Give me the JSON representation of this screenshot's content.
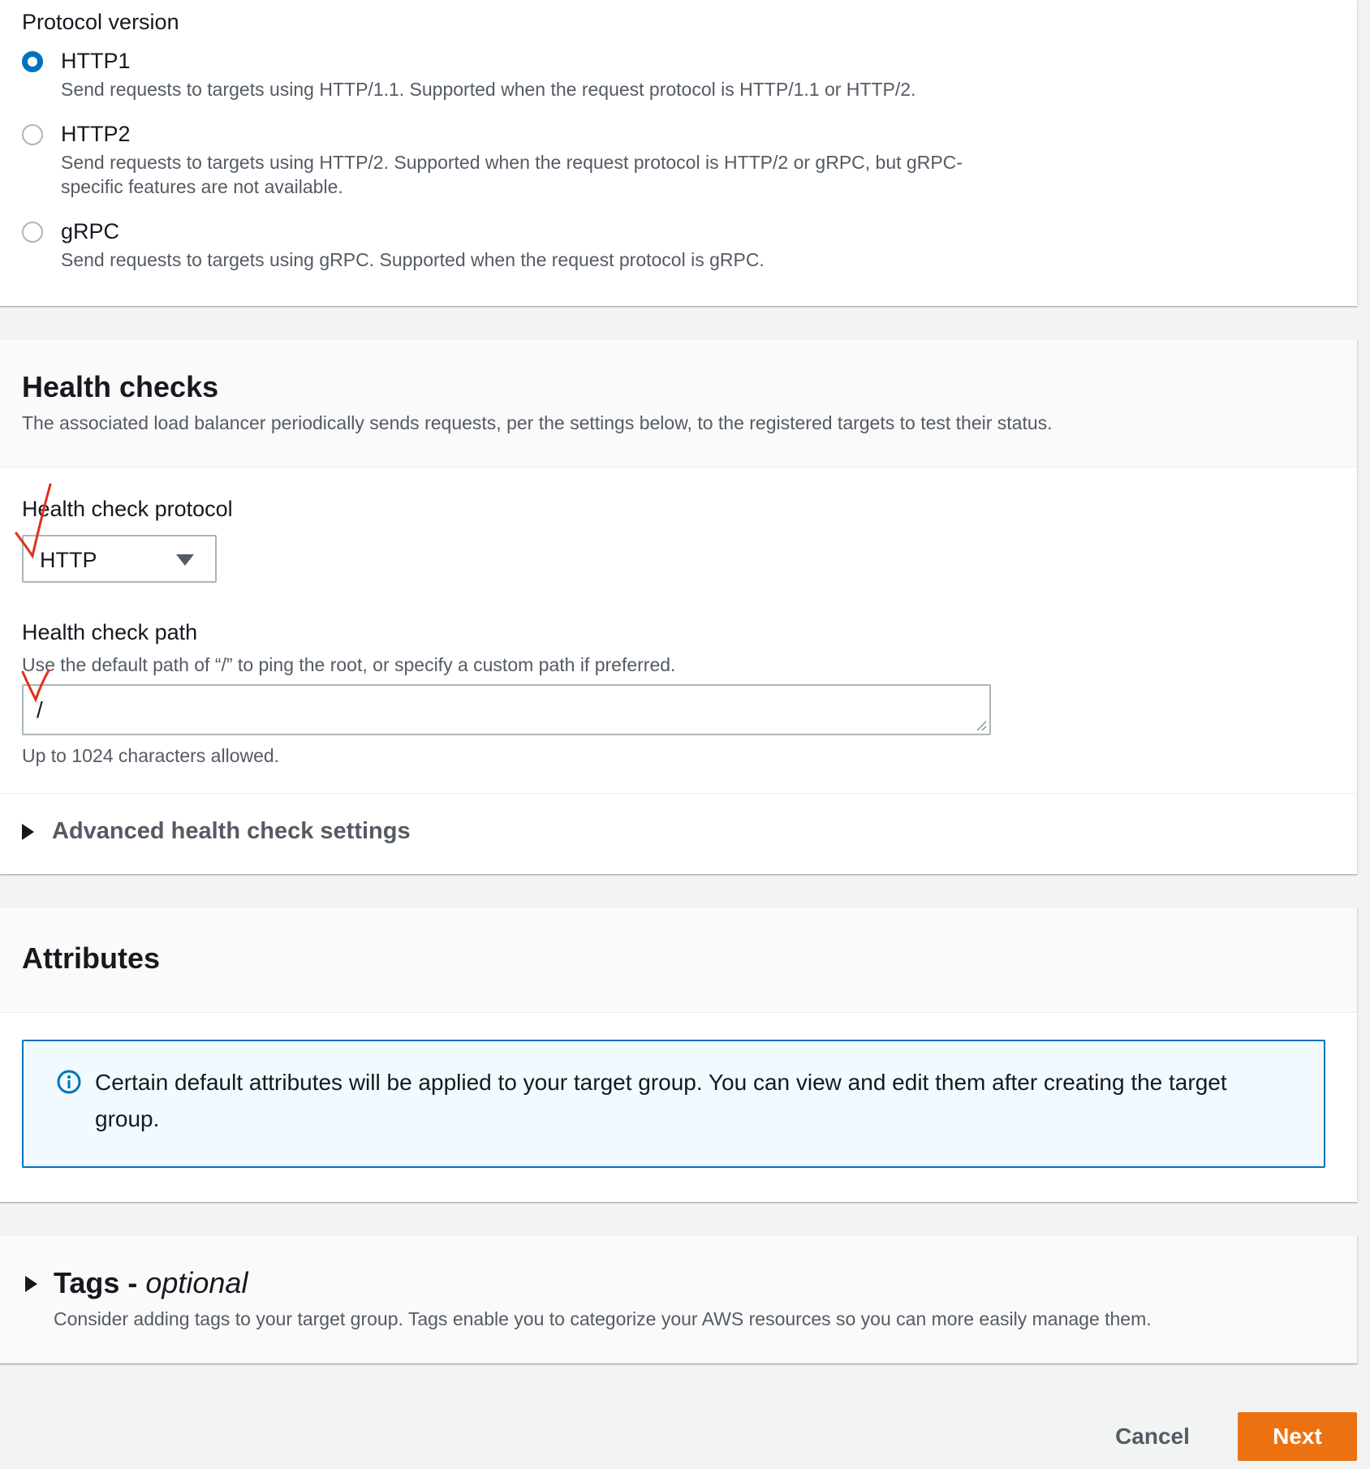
{
  "protocol": {
    "title": "Protocol version",
    "options": [
      {
        "label": "HTTP1",
        "description": "Send requests to targets using HTTP/1.1. Supported when the request protocol is HTTP/1.1 or HTTP/2.",
        "selected": true
      },
      {
        "label": "HTTP2",
        "description": "Send requests to targets using HTTP/2. Supported when the request protocol is HTTP/2 or gRPC, but gRPC-specific features are not available.",
        "selected": false
      },
      {
        "label": "gRPC",
        "description": "Send requests to targets using gRPC. Supported when the request protocol is gRPC.",
        "selected": false
      }
    ]
  },
  "health": {
    "title": "Health checks",
    "description": "The associated load balancer periodically sends requests, per the settings below, to the registered targets to test their status.",
    "protocol_label": "Health check protocol",
    "protocol_value": "HTTP",
    "path_label": "Health check path",
    "path_hint": "Use the default path of “/” to ping the root, or specify a custom path if preferred.",
    "path_value": "/",
    "path_constraint": "Up to 1024 characters allowed.",
    "advanced_label": "Advanced health check settings"
  },
  "attributes": {
    "title": "Attributes",
    "info": "Certain default attributes will be applied to your target group. You can view and edit them after creating the target group."
  },
  "tags": {
    "title": "Tags - ",
    "title_optional": "optional",
    "description": "Consider adding tags to your target group. Tags enable you to categorize your AWS resources so you can more easily manage them."
  },
  "footer": {
    "cancel_label": "Cancel",
    "next_label": "Next"
  },
  "colors": {
    "primary": "#0073bb",
    "next_button": "#ec7211",
    "annotation": "#e0301e"
  }
}
